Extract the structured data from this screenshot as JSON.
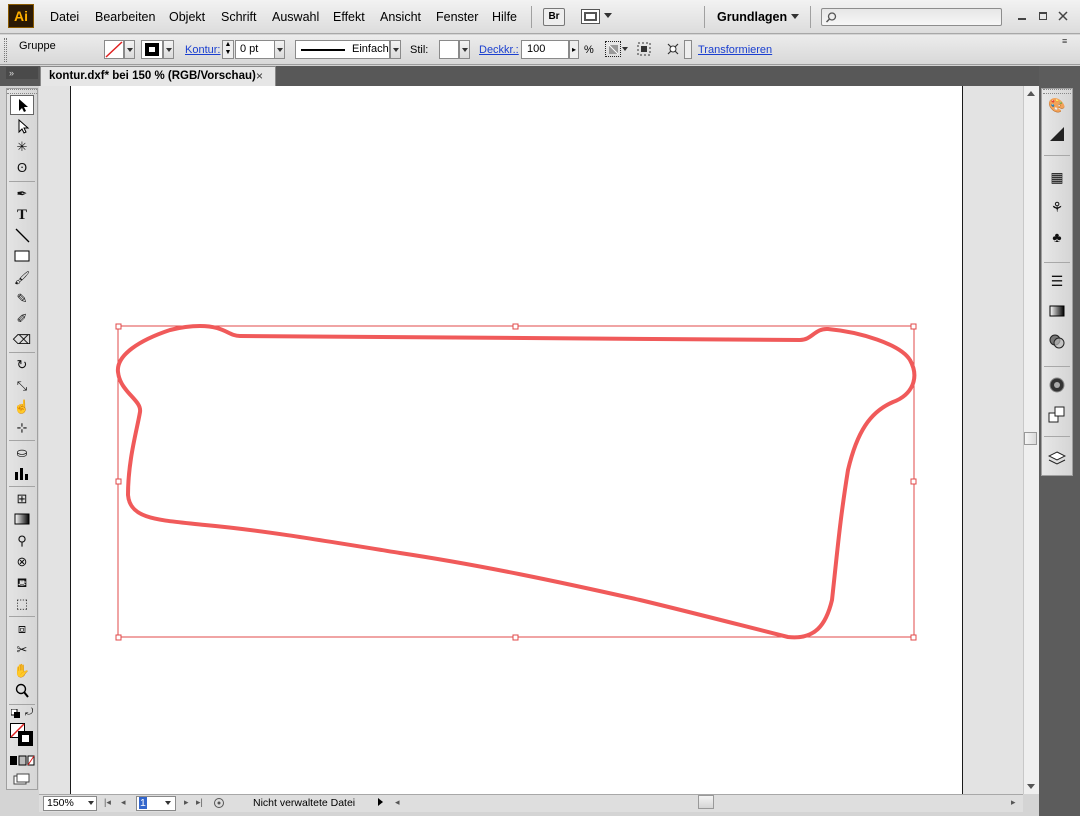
{
  "app": {
    "logo": "Ai"
  },
  "menu": [
    {
      "label": "Datei"
    },
    {
      "label": "Bearbeiten"
    },
    {
      "label": "Objekt"
    },
    {
      "label": "Schrift"
    },
    {
      "label": "Auswahl"
    },
    {
      "label": "Effekt"
    },
    {
      "label": "Ansicht"
    },
    {
      "label": "Fenster"
    },
    {
      "label": "Hilfe"
    }
  ],
  "menubar_tools": {
    "bridge_label": "Br"
  },
  "workspace": {
    "label": "Grundlagen"
  },
  "search": {
    "placeholder": ""
  },
  "control_bar": {
    "selection_type": "Gruppe",
    "stroke_label": "Kontur:",
    "stroke_weight": "0 pt",
    "stroke_style": "Einfach",
    "style_label": "Stil:",
    "opacity_label": "Deckkr.:",
    "opacity_value": "100",
    "opacity_unit": "%",
    "transform_label": "Transformieren"
  },
  "document": {
    "tab_title": "kontur.dxf* bei 150 % (RGB/Vorschau)",
    "tab_close": "×"
  },
  "status_bar": {
    "zoom": "150%",
    "page": "1",
    "status": "Nicht verwaltete Datei"
  },
  "colors": {
    "stroke": "#f05a5a",
    "selection": "#e04848"
  },
  "icons": {
    "tools": [
      "selection-tool-icon",
      "direct-selection-tool-icon",
      "magic-wand-tool-icon",
      "lasso-tool-icon",
      "pen-tool-icon",
      "type-tool-icon",
      "line-tool-icon",
      "rectangle-tool-icon",
      "paintbrush-tool-icon",
      "pencil-tool-icon",
      "blob-brush-tool-icon",
      "eraser-tool-icon",
      "rotate-tool-icon",
      "scale-tool-icon",
      "warp-tool-icon",
      "free-transform-tool-icon",
      "symbol-sprayer-tool-icon",
      "column-graph-tool-icon",
      "mesh-tool-icon",
      "gradient-tool-icon",
      "eyedropper-tool-icon",
      "blend-tool-icon",
      "live-paint-bucket-tool-icon",
      "live-paint-selection-tool-icon",
      "artboard-tool-icon",
      "slice-tool-icon",
      "hand-tool-icon",
      "zoom-tool-icon"
    ],
    "panels": [
      "color-panel-icon",
      "color-guide-panel-icon",
      "swatches-panel-icon",
      "brushes-panel-icon",
      "symbols-panel-icon",
      "stroke-panel-icon",
      "gradient-panel-icon",
      "transparency-panel-icon",
      "appearance-panel-icon",
      "graphic-styles-panel-icon",
      "layers-panel-icon"
    ]
  }
}
